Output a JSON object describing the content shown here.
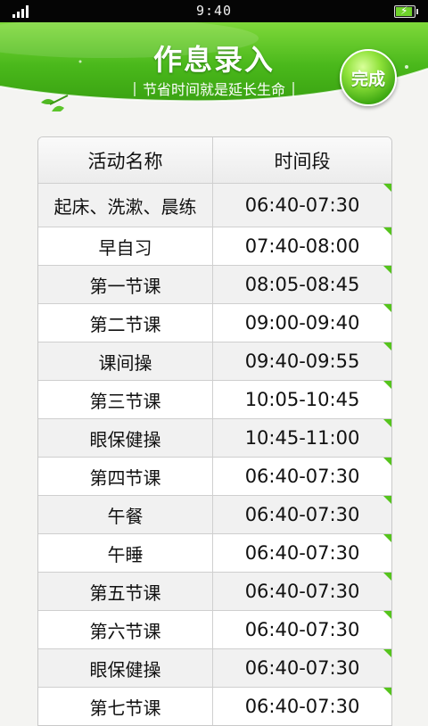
{
  "status_bar": {
    "time": "9:40"
  },
  "header": {
    "title": "作息录入",
    "subtitle": "节省时间就是延长生命",
    "done_label": "完成"
  },
  "colors": {
    "accent": "#4bb51e",
    "corner_marker": "#55c41c"
  },
  "table": {
    "columns": [
      "活动名称",
      "时间段"
    ],
    "rows": [
      {
        "activity": "起床、洗漱、晨练",
        "period": "06:40-07:30"
      },
      {
        "activity": "早自习",
        "period": "07:40-08:00"
      },
      {
        "activity": "第一节课",
        "period": "08:05-08:45"
      },
      {
        "activity": "第二节课",
        "period": "09:00-09:40"
      },
      {
        "activity": "课间操",
        "period": "09:40-09:55"
      },
      {
        "activity": "第三节课",
        "period": "10:05-10:45"
      },
      {
        "activity": "眼保健操",
        "period": "10:45-11:00"
      },
      {
        "activity": "第四节课",
        "period": "06:40-07:30"
      },
      {
        "activity": "午餐",
        "period": "06:40-07:30"
      },
      {
        "activity": "午睡",
        "period": "06:40-07:30"
      },
      {
        "activity": "第五节课",
        "period": "06:40-07:30"
      },
      {
        "activity": "第六节课",
        "period": "06:40-07:30"
      },
      {
        "activity": "眼保健操",
        "period": "06:40-07:30"
      },
      {
        "activity": "第七节课",
        "period": "06:40-07:30"
      }
    ]
  }
}
